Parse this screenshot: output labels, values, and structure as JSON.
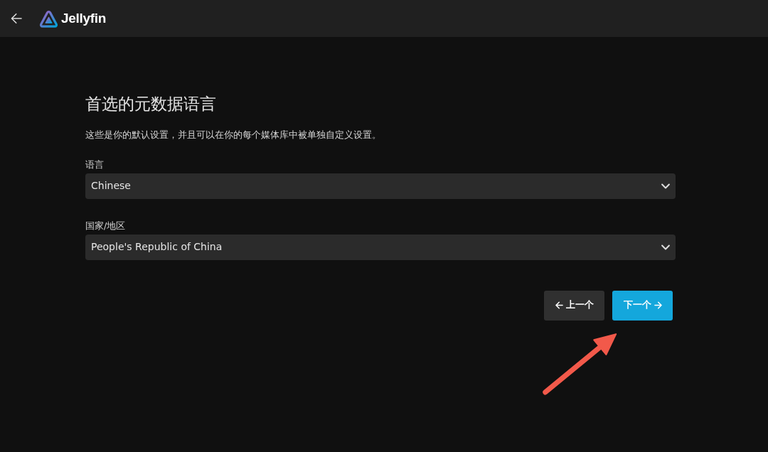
{
  "header": {
    "title": "Jellyfin"
  },
  "page": {
    "title": "首选的元数据语言",
    "description": "这些是你的默认设置，并且可以在你的每个媒体库中被单独自定义设置。",
    "fields": [
      {
        "label": "语言",
        "value": "Chinese"
      },
      {
        "label": "国家/地区",
        "value": "People's Republic of China"
      }
    ],
    "buttons": [
      {
        "label": "上一个",
        "kind": "previous"
      },
      {
        "label": "下一个",
        "kind": "next"
      }
    ]
  },
  "annotations": [
    {
      "kind": "arrow"
    }
  ]
}
